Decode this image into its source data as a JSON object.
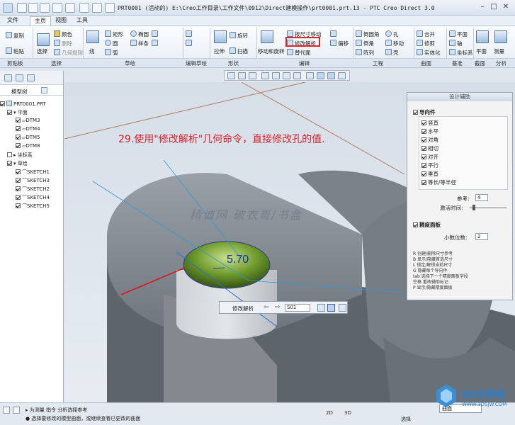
{
  "title": "PRT0001 (活动的) E:\\Creo工作目录\\工作文件\\0912\\Direct建模操作\\prt0001.prt.13 - PTC Creo Direct 3.0",
  "menu": {
    "tabs": [
      "文件",
      "主页",
      "视图",
      "工具"
    ]
  },
  "ribbon": {
    "clipboard": {
      "copy": "复制",
      "paste": "粘贴"
    },
    "select": {
      "select": "选择",
      "color": "颜色",
      "delete": "删除",
      "geom_rules": "几何规则"
    },
    "sketch": {
      "line": "线",
      "rect": "矩形",
      "ellipse": "椭圆",
      "circle": "圆",
      "spline": "样条",
      "arc": "弧",
      "fillet": "圆角",
      "chamfer": "倒角"
    },
    "edit_sketch": {
      "rotate": "旋转",
      "extrude": "拉伸",
      "sweep": "扫描"
    },
    "shape": {
      "move_rotate": "移动和旋转",
      "dim_move": "按尺寸移动",
      "modify_analysis": "修改解析",
      "replace": "替代面"
    },
    "engineering": {
      "offset": "偏移",
      "round": "倒圆角",
      "chamfer": "倒角",
      "hole": "孔",
      "shell": "壳",
      "pattern": "阵列",
      "move": "移动"
    },
    "surface": {
      "merge": "合并",
      "trim": "修剪",
      "solidify": "实体化"
    },
    "datum": {
      "plane": "平面",
      "axis": "轴",
      "csys": "坐标系"
    },
    "section": {
      "plane": "平面"
    },
    "measure": {
      "measure": "测量"
    },
    "groups": [
      "剪贴板",
      "选择",
      "草绘",
      "编辑草绘",
      "形状",
      "编辑",
      "工程",
      "曲面",
      "基准",
      "截面",
      "分析"
    ]
  },
  "tree": {
    "header": "模型树",
    "items": [
      {
        "label": "PRT0001.PRT"
      },
      {
        "label": "平面"
      },
      {
        "label": "DTM3"
      },
      {
        "label": "DTM4"
      },
      {
        "label": "DTM5"
      },
      {
        "label": "DTM8"
      },
      {
        "label": "坐标系"
      },
      {
        "label": "草绘"
      },
      {
        "label": "SKETCH1"
      },
      {
        "label": "SKETCH3"
      },
      {
        "label": "SKETCH2"
      },
      {
        "label": "SKETCH4"
      },
      {
        "label": "SKETCH5"
      }
    ]
  },
  "annotation": "29.使用\"修改解析\"几何命令，直接修改孔的值.",
  "watermark": "精诚网 破衣哥/书盒",
  "dimension_value": "5.70",
  "design_assist": {
    "title": "设计辅助",
    "guides_label": "导向件",
    "guides": [
      "竖直",
      "水平",
      "对角",
      "相切",
      "对齐",
      "平行",
      "垂直",
      "等长/等半径"
    ],
    "reference_label": "参考:",
    "reference_value": "4",
    "drag_time_label": "激活时间:",
    "precision_label": "精度面板",
    "decimals_label": "小数位数:",
    "decimals_value": "2",
    "shortcuts": [
      "R 创建/删除尺寸参考",
      "B 显示/隐藏首选尺寸",
      "L 锁定/解锁当前尺寸",
      "G 隐藏每个导向件",
      "tab 选择下一个精度面板字段",
      "空格 重改辅助标记",
      "P 显示/隐藏精度面板"
    ]
  },
  "mini_toolbar": {
    "label": "修改解析",
    "select_value": "S01"
  },
  "status": {
    "line1": "为测量 指令 分析选择参考",
    "line2": "选择要修改的模型曲面，或继续查看已更改的曲面",
    "mode_2d": "2D",
    "mode_3d": "3D",
    "select_label": "选择",
    "filter_value": "曲面"
  },
  "colors": {
    "highlight": "#e0262a",
    "annotation": "#d6202a",
    "dimension": "#1530a8",
    "hole": "#7da83a",
    "part": "#8c929c"
  }
}
